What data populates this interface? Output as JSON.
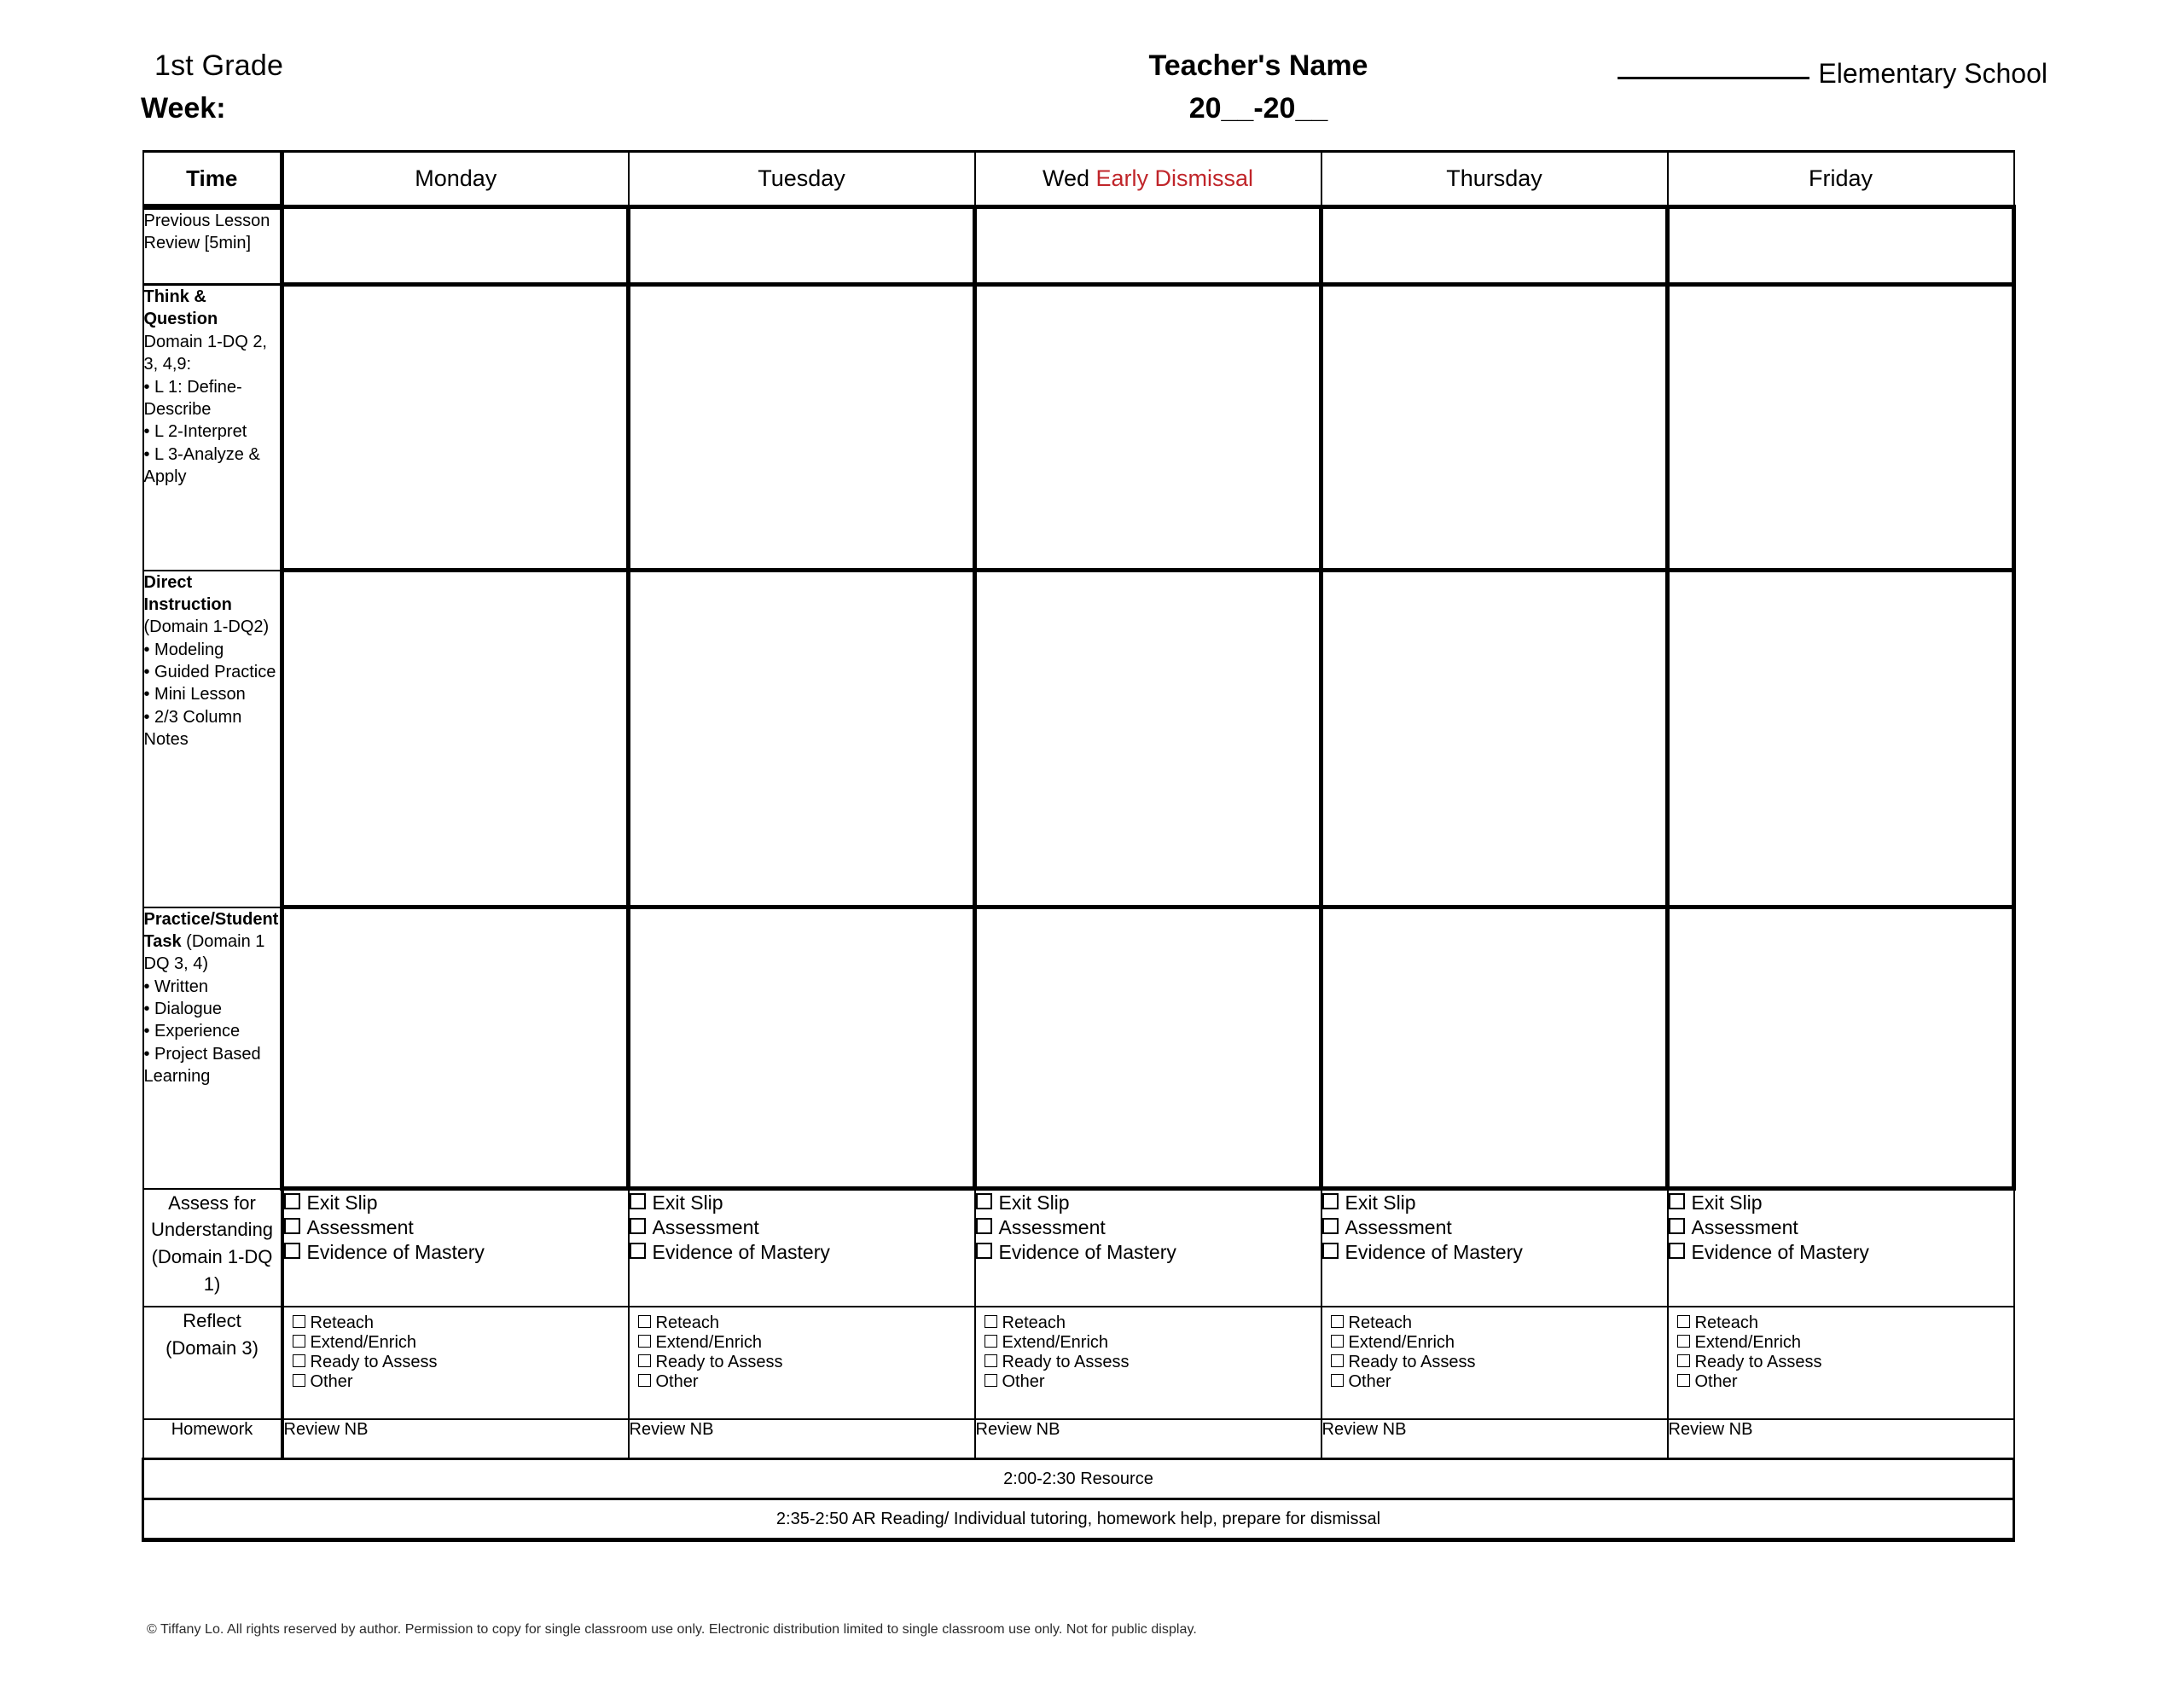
{
  "header": {
    "grade": "1st Grade",
    "week_label": "Week:",
    "teacher_name": "Teacher's Name",
    "years": "20__-20__",
    "school": "Elementary School"
  },
  "table": {
    "columns": [
      "Time",
      "Monday",
      "Tuesday",
      "Wed Early Dismissal",
      "Thursday",
      "Friday"
    ],
    "time_header": "Time",
    "days": [
      {
        "label": "Monday",
        "prefix": "",
        "highlight": ""
      },
      {
        "label": "Tuesday",
        "prefix": "",
        "highlight": ""
      },
      {
        "label": "Wed Early Dismissal",
        "prefix": "Wed ",
        "highlight": "Early Dismissal"
      },
      {
        "label": "Thursday",
        "prefix": "",
        "highlight": ""
      },
      {
        "label": "Friday",
        "prefix": "",
        "highlight": ""
      }
    ],
    "highlight_color": "#c0252a",
    "rows": [
      {
        "id": "previous-lesson-review",
        "label_plain": "Previous Lesson Review [5min]",
        "label_bold": "",
        "label_rest": "Previous Lesson Review [5min]",
        "bullets": []
      },
      {
        "id": "think-and-question",
        "label_bold": "Think & Question",
        "label_rest": "Domain 1-DQ 2, 3, 4,9:",
        "bullets": [
          "• L 1: Define-Describe",
          "• L 2-Interpret",
          "• L 3-Analyze  & Apply"
        ]
      },
      {
        "id": "direct-instruction",
        "label_bold": "Direct Instruction",
        "label_rest": "(Domain 1-DQ2)",
        "bullets": [
          "• Modeling",
          "• Guided Practice",
          "• Mini Lesson",
          "• 2/3 Column Notes"
        ]
      },
      {
        "id": "practice-student-task",
        "label_bold": "Practice/Student Task",
        "label_rest": "(Domain 1 DQ 3, 4)",
        "bullets": [
          "• Written",
          "• Dialogue",
          "• Experience",
          "• Project Based Learning"
        ]
      }
    ],
    "assess": {
      "label_line1": "Assess for",
      "label_line2": "Understanding",
      "label_line3": "(Domain 1-DQ 1)",
      "options": [
        "Exit Slip",
        "Assessment",
        "Evidence of Mastery"
      ]
    },
    "reflect": {
      "label_line1": "Reflect",
      "label_line2": "(Domain 3)",
      "options": [
        "Reteach",
        "Extend/Enrich",
        "Ready to Assess",
        "Other"
      ]
    },
    "homework": {
      "label": "Homework",
      "value": "Review NB"
    },
    "full_width_rows": [
      "2:00-2:30 Resource",
      "2:35-2:50 AR Reading/ Individual tutoring, homework help, prepare for dismissal"
    ]
  },
  "footer": {
    "copyright": "©  Tiffany Lo. All rights reserved by author. Permission to copy for single classroom use only. Electronic distribution limited to single classroom use only. Not for public display."
  }
}
